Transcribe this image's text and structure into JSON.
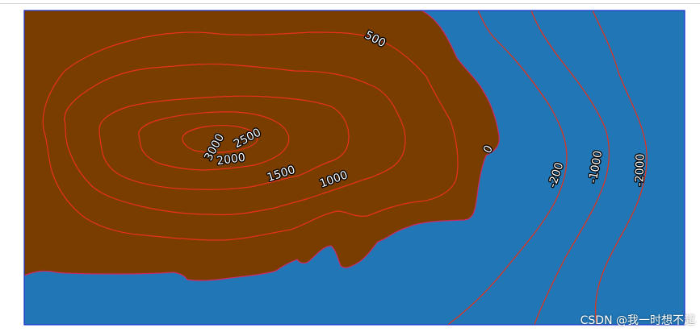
{
  "map": {
    "colors": {
      "land": "#7a3d00",
      "water": "#2176b5",
      "contour": "#e8321c",
      "coast": "#cc2a6a",
      "frame": "#1a2fd0"
    },
    "contours": [
      {
        "level": "3000",
        "label": "3000"
      },
      {
        "level": "2500",
        "label": "2500"
      },
      {
        "level": "2000",
        "label": "2000"
      },
      {
        "level": "1500",
        "label": "1500"
      },
      {
        "level": "1000",
        "label": "1000"
      },
      {
        "level": "500",
        "label": "500"
      },
      {
        "level": "0",
        "label": "0"
      },
      {
        "level": "-200",
        "label": "-200"
      },
      {
        "level": "-1000",
        "label": "-1000"
      },
      {
        "level": "-2000",
        "label": "-2000"
      }
    ]
  },
  "watermark": "CSDN @我一时想不起"
}
